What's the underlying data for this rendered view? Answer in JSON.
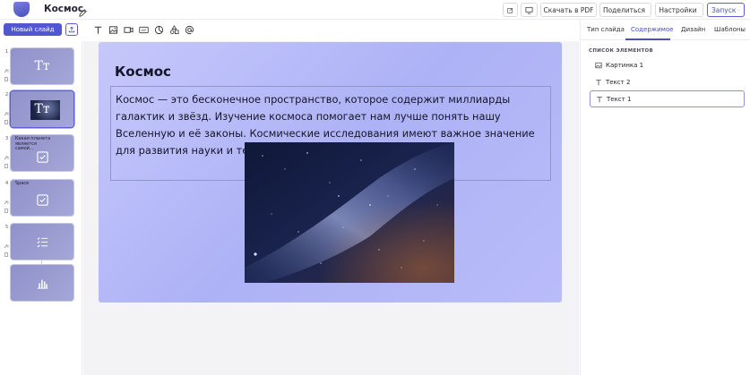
{
  "header": {
    "title": "Космос",
    "buttons": {
      "pdf": "Скачать в PDF",
      "share": "Поделиться",
      "settings": "Настройки",
      "launch": "Запуск"
    }
  },
  "toolbar": {
    "new_slide": "Новый слайд",
    "tools": [
      "text-tool-icon",
      "image-tool-icon",
      "video-tool-icon",
      "gif-tool-icon",
      "chart-tool-icon",
      "shapes-tool-icon",
      "embed-tool-icon"
    ]
  },
  "slides": [
    {
      "num": "1",
      "type": "text",
      "glyph": "Tт"
    },
    {
      "num": "2",
      "type": "text-image",
      "glyph": "Tт"
    },
    {
      "num": "3",
      "type": "quiz",
      "text": "Какая планета является самой..."
    },
    {
      "num": "4",
      "type": "quiz",
      "text": "Space"
    },
    {
      "num": "5",
      "type": "list"
    },
    {
      "num": "",
      "type": "chart"
    }
  ],
  "canvas": {
    "title": "Космос",
    "body": "Космос — это бесконечное пространство, которое содержит миллиарды галактик и звёзд. Изучение космоса помогает нам лучше понять нашу Вселенную и её законы. Космические исследования имеют важное значение для развития науки и технологий."
  },
  "right_panel": {
    "tabs": [
      "Тип слайда",
      "Содержимое",
      "Дизайн",
      "Шаблоны"
    ],
    "active_tab": "Содержимое",
    "list_heading": "СПИСОК ЭЛЕМЕНТОВ",
    "elements": [
      {
        "label": "Картинка 1",
        "icon": "image-icon"
      },
      {
        "label": "Текст 2",
        "icon": "text-icon"
      },
      {
        "label": "Текст 1",
        "icon": "text-icon",
        "selected": true
      }
    ]
  },
  "colors": {
    "accent": "#5157cf",
    "slide_bg": "#b3b7f7"
  }
}
